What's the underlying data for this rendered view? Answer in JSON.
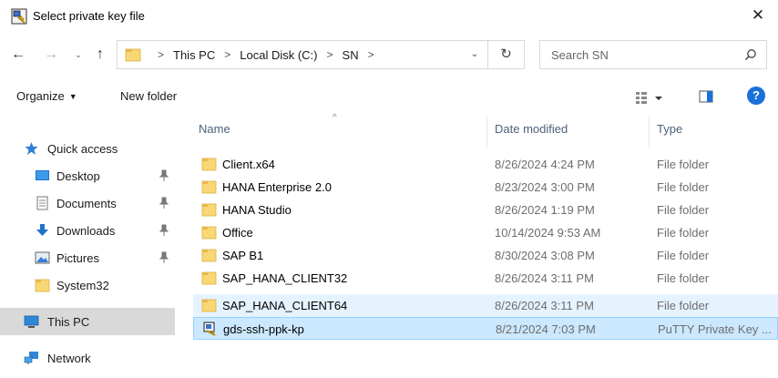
{
  "window": {
    "title": "Select private key file",
    "close_glyph": "✕"
  },
  "nav": {
    "back_glyph": "←",
    "forward_glyph": "→",
    "recent_glyph": "⌄",
    "up_glyph": "↑",
    "breadcrumbs": [
      "This PC",
      "Local Disk (C:)",
      "SN"
    ],
    "separator": ">",
    "refresh_glyph": "↻",
    "search_placeholder": "Search SN"
  },
  "toolbar": {
    "organize_label": "Organize",
    "new_folder_label": "New folder",
    "help_glyph": "?"
  },
  "sidebar": {
    "items": [
      {
        "label": "Quick access",
        "icon": "star-icon"
      },
      {
        "label": "Desktop",
        "icon": "desktop-icon",
        "pinned": true
      },
      {
        "label": "Documents",
        "icon": "documents-icon",
        "pinned": true
      },
      {
        "label": "Downloads",
        "icon": "downloads-icon",
        "pinned": true
      },
      {
        "label": "Pictures",
        "icon": "pictures-icon",
        "pinned": true
      },
      {
        "label": "System32",
        "icon": "folder-icon"
      },
      {
        "label": "This PC",
        "icon": "computer-icon",
        "selected": true
      },
      {
        "label": "Network",
        "icon": "network-icon"
      }
    ]
  },
  "columns": {
    "name": "Name",
    "date": "Date modified",
    "type": "Type"
  },
  "files": [
    {
      "name": "Client.x64",
      "date": "8/26/2024 4:24 PM",
      "type": "File folder"
    },
    {
      "name": "HANA Enterprise 2.0",
      "date": "8/23/2024 3:00 PM",
      "type": "File folder"
    },
    {
      "name": "HANA Studio",
      "date": "8/26/2024 1:19 PM",
      "type": "File folder"
    },
    {
      "name": "Office",
      "date": "10/14/2024 9:53 AM",
      "type": "File folder"
    },
    {
      "name": "SAP B1",
      "date": "8/30/2024 3:08 PM",
      "type": "File folder"
    },
    {
      "name": "SAP_HANA_CLIENT32",
      "date": "8/26/2024 3:11 PM",
      "type": "File folder"
    },
    {
      "name": "SAP_HANA_CLIENT64",
      "date": "8/26/2024 3:11 PM",
      "type": "File folder"
    },
    {
      "name": "gds-ssh-ppk-kp",
      "date": "8/21/2024 7:03 PM",
      "type": "PuTTY Private Key ..."
    }
  ],
  "colors": {
    "folder": "#f8d775",
    "folder_dark": "#e8b84a",
    "accent": "#1a6fd8",
    "hover_row": "#e5f3ff",
    "selected_row": "#cce8ff"
  }
}
